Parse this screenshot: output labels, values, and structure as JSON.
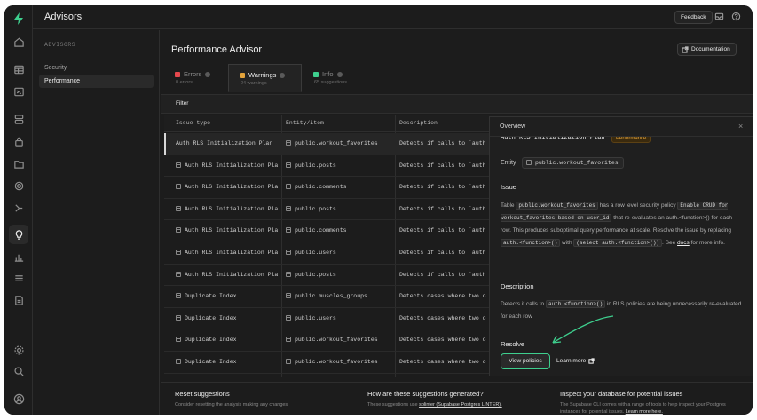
{
  "app": {
    "title": "Advisors",
    "feedback_label": "Feedback"
  },
  "sidebar": {
    "heading": "ADVISORS",
    "items": [
      {
        "label": "Security"
      },
      {
        "label": "Performance"
      }
    ]
  },
  "page": {
    "title": "Performance Advisor",
    "doc_label": "Documentation"
  },
  "tabs": [
    {
      "label": "Errors",
      "sub": "0 errors",
      "color": "#e5484d"
    },
    {
      "label": "Warnings",
      "sub": "24 warnings",
      "color": "#e3a33b"
    },
    {
      "label": "Info",
      "sub": "65 suggestions",
      "color": "#3ecf8e"
    }
  ],
  "filter_label": "Filter",
  "table": {
    "headers": [
      "Issue type",
      "Entity/item",
      "Description"
    ],
    "rows": [
      {
        "issue": "Auth RLS Initialization Plan",
        "entity": "public.workout_favorites",
        "desc": "Detects if calls to `auth"
      },
      {
        "issue": "Auth RLS Initialization Plan",
        "entity": "public.posts",
        "desc": "Detects if calls to `auth"
      },
      {
        "issue": "Auth RLS Initialization Plan",
        "entity": "public.comments",
        "desc": "Detects if calls to `auth"
      },
      {
        "issue": "Auth RLS Initialization Plan",
        "entity": "public.posts",
        "desc": "Detects if calls to `auth"
      },
      {
        "issue": "Auth RLS Initialization Plan",
        "entity": "public.comments",
        "desc": "Detects if calls to `auth"
      },
      {
        "issue": "Auth RLS Initialization Plan",
        "entity": "public.users",
        "desc": "Detects if calls to `auth"
      },
      {
        "issue": "Auth RLS Initialization Plan",
        "entity": "public.posts",
        "desc": "Detects if calls to `auth"
      },
      {
        "issue": "Duplicate Index",
        "entity": "public.muscles_groups",
        "desc": "Detects cases where two o"
      },
      {
        "issue": "Duplicate Index",
        "entity": "public.users",
        "desc": "Detects cases where two o"
      },
      {
        "issue": "Duplicate Index",
        "entity": "public.workout_favorites",
        "desc": "Detects cases where two o"
      },
      {
        "issue": "Duplicate Index",
        "entity": "public.workout_favorites",
        "desc": "Detects cases where two o"
      }
    ]
  },
  "footer": {
    "reset_title": "Reset suggestions",
    "reset_text": "Consider resetting the analysis making any changes",
    "how_title": "How are these suggestions generated?",
    "how_text": "These suggestions use",
    "how_link": "splinter (Supabase Postgres LINTER).",
    "inspect_title": "Inspect your database for potential issues",
    "inspect_text": "The Supabase CLI comes with a range of tools to help inspect your Postgres instances for potential issues.",
    "inspect_link": "Learn more here."
  },
  "panel": {
    "title": "Overview",
    "name": "Auth RLS Initialization Plan",
    "badge": "Performance",
    "entity_label": "Entity",
    "entity_value": "public.workout_favorites",
    "issue_heading": "Issue",
    "issue_text": {
      "t1": "Table",
      "c1": "public.workout_favorites",
      "t2": "has a row level security policy",
      "c2": "Enable CRUD for workout_favorites based on user_id",
      "t3": "that re-evaluates an auth.<function>() for each row. This produces suboptimal query performance at scale. Resolve the issue by replacing",
      "c3": "auth.<function>()",
      "t4": "with",
      "c4": "(select auth.<function>())",
      "t5": ". See",
      "link": "docs",
      "t6": "for more info."
    },
    "desc_heading": "Description",
    "desc_text": {
      "t1": "Detects if calls to",
      "c1": "auth.<function>()",
      "t2": "in RLS policies are being unnecessarily re-evaluated for each row"
    },
    "resolve_heading": "Resolve",
    "view_policies": "View policies",
    "learn_more": "Learn more"
  },
  "colors": {
    "accent": "#3ecf8e",
    "warning": "#e3a33b",
    "error": "#e5484d"
  }
}
